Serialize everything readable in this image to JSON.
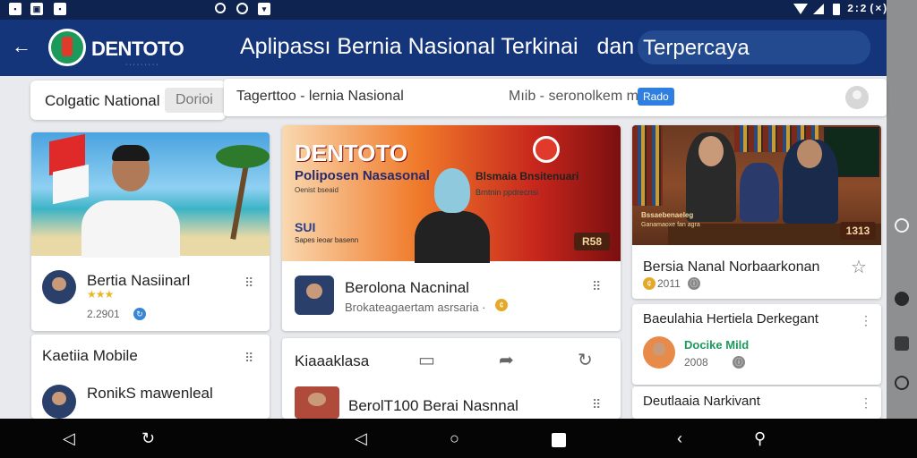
{
  "status_bar": {
    "left_icons": [
      "notification-icon",
      "photo-icon",
      "notification-icon"
    ],
    "center_icons": [
      "location-icon",
      "record-icon",
      "app-icon"
    ],
    "right_icons": [
      "wifi-icon",
      "signal-icon",
      "battery-icon"
    ],
    "time": "2:2",
    "extra": "(×)"
  },
  "app_bar": {
    "brand": "DENTOTO",
    "title": "Aplipassı Bernia Nasional Terkinai",
    "title_conj": "dan",
    "title_pill": "Terpercaya"
  },
  "filters": {
    "national_label": "Colgatic National",
    "chip_label": "Dorioi",
    "search_query": "Tagerttoo - lernia Nasional",
    "search_hint": "Mıib - seronolkem m",
    "badge": "Rado"
  },
  "column1": {
    "card1": {
      "title": "Bertia Nasiinarl",
      "meta": "2.2901",
      "rating": "★★★"
    },
    "card2": {
      "header": "Kaetiia Mobile",
      "item_title": "RonikS mawenleal"
    }
  },
  "column2": {
    "hero": {
      "poster_brand": "DENTOTO",
      "poster_line1": "Poliposen Nasasonal",
      "poster_line2": "Oenist bseaid",
      "poster_line3": "SUI",
      "poster_line4": "Sapes ieoar basenn",
      "poster_right1": "Blsmaia Bnsitenuari",
      "poster_right2": "Brntnin ppdrecnsi",
      "poster_tag": "R58",
      "title": "Berolona Nacninal",
      "meta": "Brokateagaertam asrsaria ·"
    },
    "card2": {
      "header": "Kiaaaklasa",
      "item_title": "BerolT100 Berai Nasnnal"
    }
  },
  "column3": {
    "hero": {
      "office_line1": "Bssaebenaeleg",
      "office_line2": "Ganamaoxe fan agra",
      "office_tag": "1313",
      "title": "Bersia Nanal Norbaarkonan",
      "meta": "2011"
    },
    "card2": {
      "title": "Baeulahia Hertiela Derkegant",
      "author": "Docike Mild",
      "meta": "2008"
    },
    "card3": {
      "title": "Deutlaaia Narkivant"
    }
  },
  "colors": {
    "app_bar": "#14357a",
    "status_bar": "#0f2350",
    "accent": "#2f7fe0"
  }
}
